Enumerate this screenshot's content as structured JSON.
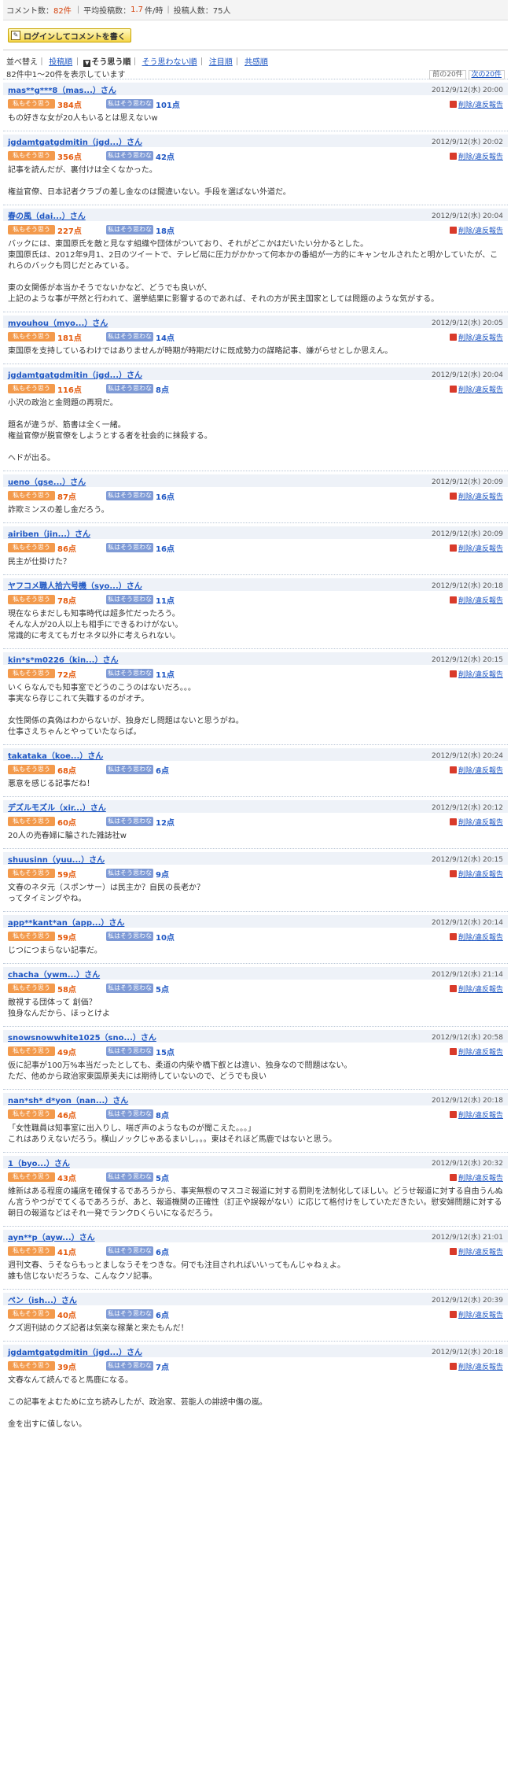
{
  "stats": {
    "comments_label": "コメント数：",
    "comments": "82件",
    "avg_label": "平均投稿数：",
    "avg": "1.7",
    "avg_unit": "件/時",
    "posters_label": "投稿人数：",
    "posters": "75人"
  },
  "login_button": "ログインしてコメントを書く",
  "sort": {
    "label": "並べ替え",
    "items": [
      "投稿順",
      "そう思う順",
      "そう思わない順",
      "注目順",
      "共感順"
    ],
    "current": "そう思う順"
  },
  "count_text": "82件中1〜20件を表示しています",
  "pager": {
    "prev": "前の20件",
    "next": "次の20件"
  },
  "labels": {
    "agree": "私もそう思う",
    "disagree": "私はそう思わない",
    "report": "削除/違反報告",
    "pt_suffix": "点"
  },
  "colors": {
    "agree": "#f39a4c",
    "disagree": "#7e9ad6",
    "link": "#1f57c3",
    "header_bg": "#eef2f8"
  },
  "comments": [
    {
      "user": "mas**g***8（mas...）さん",
      "date": "2012/9/12(水) 20:00",
      "agree": "384",
      "disagree": "101",
      "text": [
        "もの好きな女が20人もいるとは思えないw"
      ]
    },
    {
      "user": "jgdamtgatgdmitin（jgd...）さん",
      "date": "2012/9/12(水) 20:02",
      "agree": "356",
      "disagree": "42",
      "text": [
        "記事を読んだが、裏付けは全くなかった。",
        "",
        "権益官僚、日本記者クラブの差し金なのは間違いない。手段を選ばない外道だ。"
      ]
    },
    {
      "user": "春の風（dai...）さん",
      "date": "2012/9/12(水) 20:04",
      "agree": "227",
      "disagree": "18",
      "text": [
        "バックには、東国原氏を敵と見なす組織や団体がついており、それがどこかはだいたい分かるとした。",
        "東国原氏は、2012年9月1、2日のツイートで、テレビ局に圧力がかかって何本かの番組が一方的にキャンセルされたと明かしていたが、これらのバックも同じだとみている。",
        "",
        "東の女関係が本当かそうでないかなど、どうでも良いが、",
        "上記のような事が平然と行われて、選挙結果に影響するのであれば、それの方が民主国家としては問題のような気がする。"
      ]
    },
    {
      "user": "myouhou（myo...）さん",
      "date": "2012/9/12(水) 20:05",
      "agree": "181",
      "disagree": "14",
      "text": [
        "東国原を支持しているわけではありませんが時期が時期だけに既成勢力の謀略記事、嫌がらせとしか思えん。"
      ]
    },
    {
      "user": "jgdamtgatgdmitin（jgd...）さん",
      "date": "2012/9/12(水) 20:04",
      "agree": "116",
      "disagree": "8",
      "text": [
        "小沢の政治と金問題の再現だ。",
        "",
        "題名が違うが、筋書は全く一緒。",
        "権益官僚が脱官僚をしようとする者を社会的に抹殺する。",
        "",
        "ヘドが出る。"
      ]
    },
    {
      "user": "ueno（gse...）さん",
      "date": "2012/9/12(水) 20:09",
      "agree": "87",
      "disagree": "16",
      "text": [
        "詐欺ミンスの差し金だろう。"
      ]
    },
    {
      "user": "airiben（jin...）さん",
      "date": "2012/9/12(水) 20:09",
      "agree": "86",
      "disagree": "16",
      "text": [
        "民主が仕掛けた？"
      ]
    },
    {
      "user": "ヤフコメ職人拾六号機（syo...）さん",
      "date": "2012/9/12(水) 20:18",
      "agree": "78",
      "disagree": "11",
      "text": [
        "現在ならまだしも知事時代は超多忙だったろう。",
        "そんな人が20人以上も相手にできるわけがない。",
        "常識的に考えてもガセネタ以外に考えられない。"
      ]
    },
    {
      "user": "kin*s*m0226（kin...）さん",
      "date": "2012/9/12(水) 20:15",
      "agree": "72",
      "disagree": "11",
      "text": [
        "いくらなんでも知事室でどうのこうのはないだろ。。。",
        "事実なら存じこれて失職するのがオチ。",
        "",
        "女性関係の真偽はわからないが、独身だし問題はないと思うがね。",
        "仕事さえちゃんとやっていたならば。"
      ]
    },
    {
      "user": "takataka（koe...）さん",
      "date": "2012/9/12(水) 20:24",
      "agree": "68",
      "disagree": "6",
      "text": [
        "悪意を感じる記事だね！"
      ]
    },
    {
      "user": "デズルモズル（xir...）さん",
      "date": "2012/9/12(水) 20:12",
      "agree": "60",
      "disagree": "12",
      "text": [
        "20人の売春婦に騙された雑誌社w"
      ]
    },
    {
      "user": "shuusinn（yuu...）さん",
      "date": "2012/9/12(水) 20:15",
      "agree": "59",
      "disagree": "9",
      "text": [
        "文春のネタ元（スポンサー）は民主か？自民の長老か？",
        "ってタイミングやね。"
      ]
    },
    {
      "user": "app**kant*an（app...）さん",
      "date": "2012/9/12(水) 20:14",
      "agree": "59",
      "disagree": "10",
      "text": [
        "じつにつまらない記事だ。"
      ]
    },
    {
      "user": "chacha（ywm...）さん",
      "date": "2012/9/12(水) 21:14",
      "agree": "58",
      "disagree": "5",
      "text": [
        "敵視する団体って 創価？",
        "独身なんだから、ほっとけよ"
      ]
    },
    {
      "user": "snowsnowwhite1025（sno...）さん",
      "date": "2012/9/12(水) 20:58",
      "agree": "49",
      "disagree": "15",
      "text": [
        "仮に記事が100万%本当だったとしても、柔道の内柴や橋下叡とは違い、独身なので問題はない。",
        "ただ、他めから政治家東国原美夫には期待していないので、どうでも良い"
      ]
    },
    {
      "user": "nan*sh* d*yon（nan...）さん",
      "date": "2012/9/12(水) 20:18",
      "agree": "46",
      "disagree": "8",
      "text": [
        "「女性職員は知事室に出入りし、喘ぎ声のようなものが聞こえた。。。」",
        "これはありえないだろう。横山ノックじゃあるまいし。。。東はそれほど馬鹿ではないと思う。"
      ]
    },
    {
      "user": "1（byo...）さん",
      "date": "2012/9/12(水) 20:32",
      "agree": "43",
      "disagree": "5",
      "text": [
        "維新はある程度の議席を確保するであろうから、事実無根のマスコミ報道に対する罰則を法制化してほしい。どうせ報道に対する自由うんぬん言うやつがでてくるであろうが、あと、報道機関の正確性（訂正や誤報がない）に応じて格付けをしていただきたい。慰安婦問題に対する朝日の報道などはそれ一発でランクDくらいになるだろう。"
      ]
    },
    {
      "user": "ayn**p（ayw...）さん",
      "date": "2012/9/12(水) 21:01",
      "agree": "41",
      "disagree": "6",
      "text": [
        "週刊文春、うそならもっとましなうそをつきな。何でも注目されればいいってもんじゃねぇよ。",
        "誰も信じないだろうな、こんなクソ記事。"
      ]
    },
    {
      "user": "ペン（ish...）さん",
      "date": "2012/9/12(水) 20:39",
      "agree": "40",
      "disagree": "6",
      "text": [
        "クズ週刊誌のクズ記者は気楽な稼業と来たもんだ！"
      ]
    },
    {
      "user": "jgdamtgatgdmitin（jgd...）さん",
      "date": "2012/9/12(水) 20:18",
      "agree": "39",
      "disagree": "7",
      "text": [
        "文春なんて読んでると馬鹿になる。",
        "",
        "この記事をよむために立ち読みしたが、政治家、芸能人の誹謗中傷の嵐。",
        "",
        "金を出すに値しない。"
      ]
    }
  ]
}
